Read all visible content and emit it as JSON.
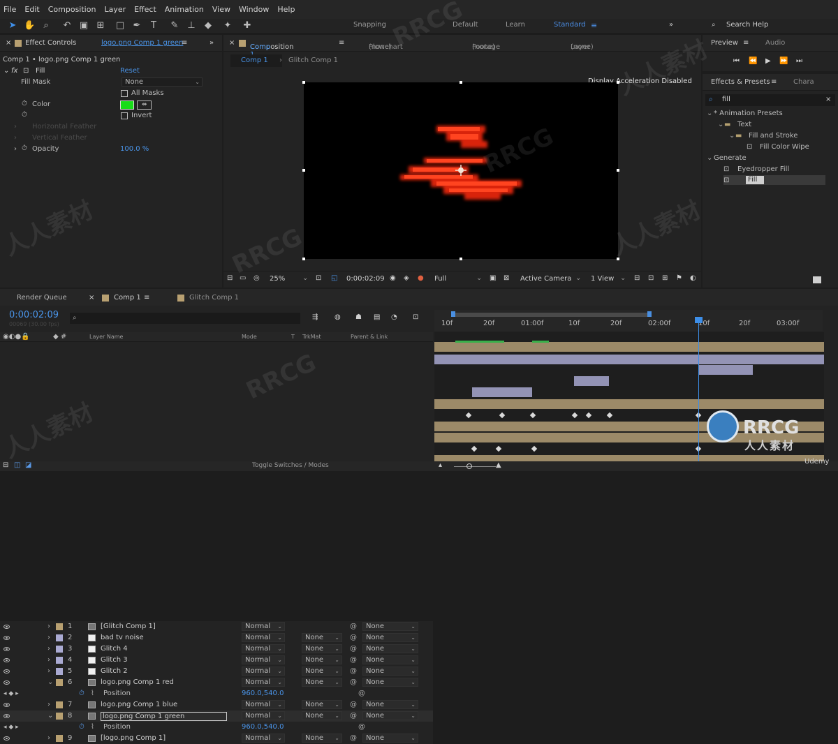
{
  "menu": [
    "File",
    "Edit",
    "Composition",
    "Layer",
    "Effect",
    "Animation",
    "View",
    "Window",
    "Help"
  ],
  "toolbar": {
    "snapping": "Snapping",
    "workspaces": [
      "Default",
      "Learn",
      "Standard"
    ],
    "search_help": "Search Help"
  },
  "effect_controls": {
    "tab_prefix": "Effect Controls",
    "tab_layer": "logo.png Comp 1 green",
    "subtitle": "Comp 1 • logo.png Comp 1 green",
    "effect_name": "Fill",
    "reset": "Reset",
    "fill_mask_label": "Fill Mask",
    "fill_mask_value": "None",
    "all_masks": "All Masks",
    "color_label": "Color",
    "color_value": "#18dd18",
    "invert": "Invert",
    "horizontal_feather": "Horizontal Feather",
    "vertical_feather": "Vertical Feather",
    "opacity_label": "Opacity",
    "opacity_value": "100.0 %"
  },
  "composition": {
    "tabs": [
      {
        "label": "Composition",
        "value": "Comp 1"
      },
      {
        "label": "Flowchart",
        "value": "(none)"
      },
      {
        "label": "Footage",
        "value": "(none)"
      },
      {
        "label": "Layer",
        "value": "(none)"
      }
    ],
    "subtabs": [
      "Comp 1",
      "Glitch Comp 1"
    ],
    "display_note": "Display Acceleration Disabled",
    "zoom": "25%",
    "timecode": "0:00:02:09",
    "resolution": "Full",
    "camera": "Active Camera",
    "views": "1 View"
  },
  "right_panels": {
    "preview_tabs": [
      "Preview",
      "Audio"
    ],
    "effects_tabs": [
      "Effects & Presets",
      "Chara"
    ],
    "search_value": "fill",
    "tree": [
      {
        "label": "* Animation Presets",
        "level": 0
      },
      {
        "label": "Text",
        "level": 1
      },
      {
        "label": "Fill and Stroke",
        "level": 2
      },
      {
        "label": "Fill Color Wipe",
        "level": 3
      },
      {
        "label": "Generate",
        "level": 0
      },
      {
        "label": "Eyedropper Fill",
        "level": 2
      },
      {
        "label": "Fill",
        "level": 2
      }
    ]
  },
  "timeline": {
    "tabs": [
      "Render Queue",
      "Comp 1",
      "Glitch Comp 1"
    ],
    "timecode": "0:00:02:09",
    "fps_note": "00069 (30.00 fps)",
    "headers": {
      "layer_name": "Layer Name",
      "mode": "Mode",
      "t": "T",
      "trkmat": "TrkMat",
      "parent": "Parent & Link"
    },
    "ruler": [
      "10f",
      "20f",
      "01:00f",
      "10f",
      "20f",
      "02:00f",
      "10f",
      "20f",
      "03:00f"
    ],
    "layers": [
      {
        "num": "1",
        "name": "[Glitch Comp 1]",
        "mode": "Normal",
        "trkmat": "",
        "parent": "None"
      },
      {
        "num": "2",
        "name": "bad tv noise",
        "mode": "Normal",
        "trkmat": "None",
        "parent": "None"
      },
      {
        "num": "3",
        "name": "Glitch 4",
        "mode": "Normal",
        "trkmat": "None",
        "parent": "None"
      },
      {
        "num": "4",
        "name": "Glitch 3",
        "mode": "Normal",
        "trkmat": "None",
        "parent": "None"
      },
      {
        "num": "5",
        "name": "Glitch 2",
        "mode": "Normal",
        "trkmat": "None",
        "parent": "None"
      },
      {
        "num": "6",
        "name": "logo.png Comp 1 red",
        "mode": "Normal",
        "trkmat": "None",
        "parent": "None"
      },
      {
        "num": "",
        "name": "Position",
        "value": "960.0,540.0"
      },
      {
        "num": "7",
        "name": "logo.png Comp 1 blue",
        "mode": "Normal",
        "trkmat": "None",
        "parent": "None"
      },
      {
        "num": "8",
        "name": "logo.png Comp 1 green",
        "mode": "Normal",
        "trkmat": "None",
        "parent": "None"
      },
      {
        "num": "",
        "name": "Position",
        "value": "960.0,540.0"
      },
      {
        "num": "9",
        "name": "[logo.png Comp 1]",
        "mode": "Normal",
        "trkmat": "None",
        "parent": "None"
      }
    ],
    "toggle_label": "Toggle Switches / Modes"
  },
  "watermarks": {
    "rrcg": "RRCG",
    "chinese": "人人素材",
    "udemy": "Udemy"
  },
  "colors": {
    "accent": "#4a95ea",
    "layer_tan": "#b8a071",
    "layer_lavender": "#aaaad2",
    "comp_bg": "#000000",
    "glitch": "#ff3311"
  }
}
